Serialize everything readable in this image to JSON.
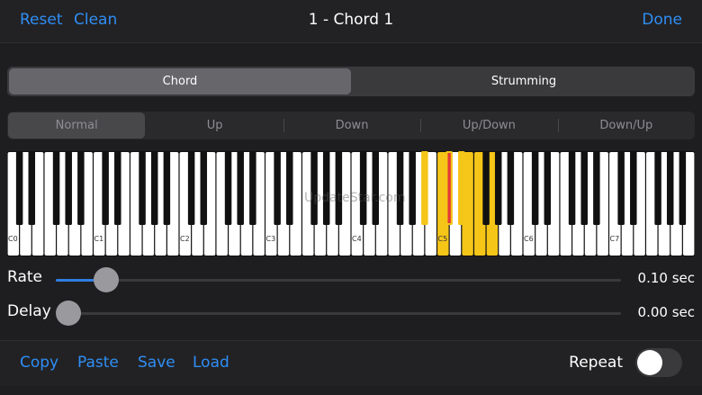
{
  "nav": {
    "reset": "Reset",
    "clean": "Clean",
    "title": "1 - Chord 1",
    "done": "Done"
  },
  "mode_tabs": {
    "selected": 0,
    "items": [
      "Chord",
      "Strumming"
    ]
  },
  "direction_tabs": {
    "selected": 0,
    "items": [
      "Normal",
      "Up",
      "Down",
      "Up/Down",
      "Down/Up"
    ]
  },
  "keyboard": {
    "octave_labels": [
      "C0",
      "C1",
      "C2",
      "C3",
      "C4",
      "C5",
      "C6",
      "C7"
    ],
    "white_key_count": 56,
    "highlight_color": "#f5c518",
    "marker_color": "#e53935",
    "highlighted_notes": [
      "A#4",
      "C5",
      "C#5",
      "D#5",
      "E5",
      "F5",
      "G5"
    ],
    "marked_notes": [
      "C#5"
    ],
    "watermark": "UpdateStar.com"
  },
  "rate": {
    "label": "Rate",
    "value": "0.10 sec",
    "fraction": 0.07
  },
  "delay": {
    "label": "Delay",
    "value": "0.00 sec",
    "fraction": 0.0
  },
  "bottom": {
    "copy": "Copy",
    "paste": "Paste",
    "save": "Save",
    "load": "Load",
    "repeat": "Repeat",
    "repeat_on": false
  },
  "colors": {
    "accent": "#2f8ef5",
    "background": "#1e1e20"
  }
}
